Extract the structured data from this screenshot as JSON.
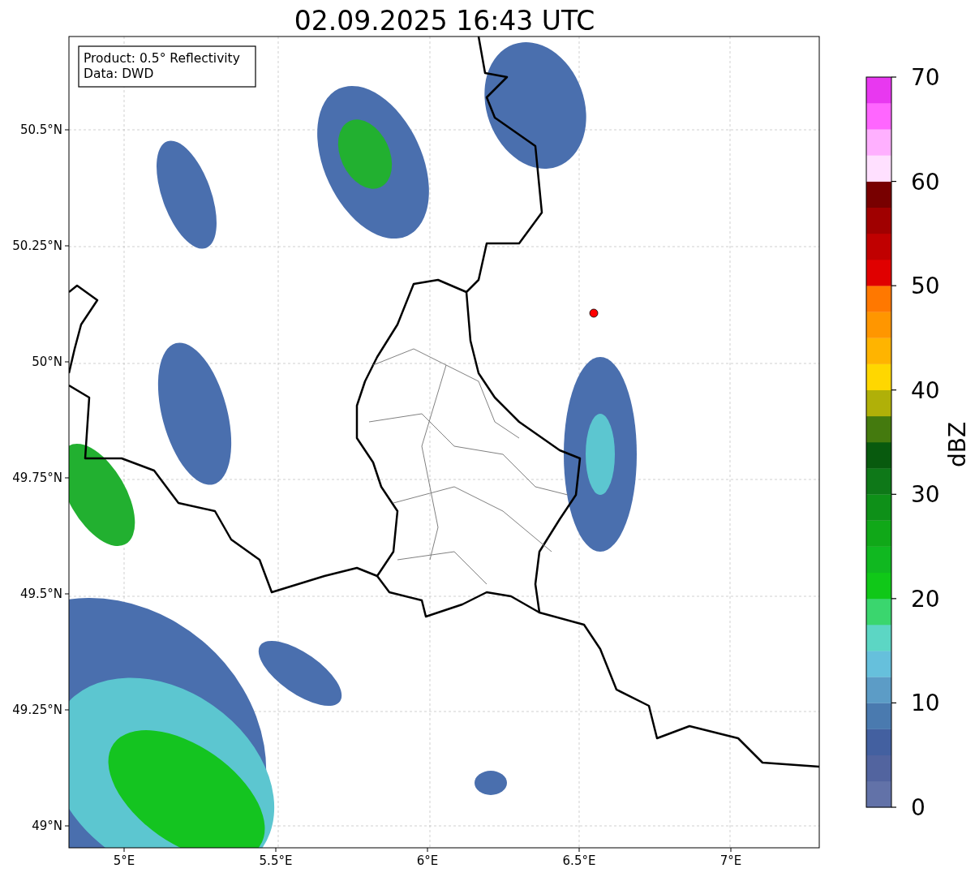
{
  "title": "02.09.2025 16:43 UTC",
  "legend": [
    "Product: 0.5° Reflectivity",
    "Data: DWD"
  ],
  "lat_ticks": [
    "50.5°N",
    "50.25°N",
    "50°N",
    "49.75°N",
    "49.5°N",
    "49.25°N",
    "49°N"
  ],
  "lon_ticks": [
    "5°E",
    "5.5°E",
    "6°E",
    "6.5°E",
    "7°E"
  ],
  "colorbar": {
    "label": "dBZ",
    "ticks": [
      "70",
      "60",
      "50",
      "40",
      "30",
      "20",
      "10",
      "0"
    ],
    "segments": [
      {
        "color": "#6272a8"
      },
      {
        "color": "#52649f"
      },
      {
        "color": "#4360a0"
      },
      {
        "color": "#4a7aaf"
      },
      {
        "color": "#5c9cc6"
      },
      {
        "color": "#66c0dc"
      },
      {
        "color": "#5cd6c4"
      },
      {
        "color": "#3ad66e"
      },
      {
        "color": "#10c818"
      },
      {
        "color": "#10b820"
      },
      {
        "color": "#10a818"
      },
      {
        "color": "#0e9018"
      },
      {
        "color": "#0e7818"
      },
      {
        "color": "#085a0e"
      },
      {
        "color": "#447a0e"
      },
      {
        "color": "#b0b008"
      },
      {
        "color": "#ffd700"
      },
      {
        "color": "#ffb400"
      },
      {
        "color": "#ff9600"
      },
      {
        "color": "#ff7800"
      },
      {
        "color": "#e00000"
      },
      {
        "color": "#c00000"
      },
      {
        "color": "#a00000"
      },
      {
        "color": "#780000"
      },
      {
        "color": "#ffe0ff"
      },
      {
        "color": "#ffb0ff"
      },
      {
        "color": "#ff66ff"
      },
      {
        "color": "#e838f0"
      }
    ]
  }
}
